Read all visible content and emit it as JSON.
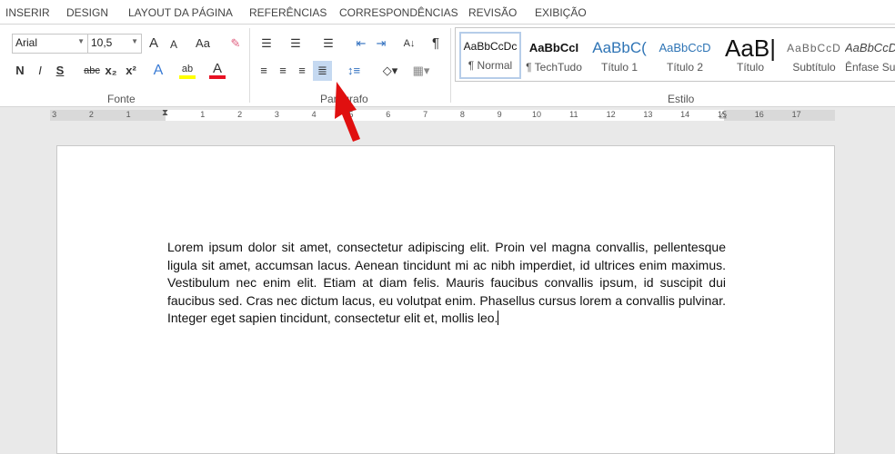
{
  "tabs": [
    "INSERIR",
    "DESIGN",
    "LAYOUT DA PÁGINA",
    "REFERÊNCIAS",
    "CORRESPONDÊNCIAS",
    "REVISÃO",
    "EXIBIÇÃO"
  ],
  "font": {
    "name": "Arial",
    "size": "10,5",
    "grow": "A",
    "shrink": "A",
    "case": "Aa",
    "bold": "N",
    "italic": "I",
    "underline": "S",
    "strike": "abc",
    "sub": "x₂",
    "sup": "x²",
    "effects": "A",
    "highlight": "ab",
    "color": "A",
    "group": "Fonte",
    "highlight_color": "#ffff00",
    "font_color": "#e81123"
  },
  "paragraph": {
    "group": "Paragrafo",
    "sort": "A↓",
    "pilcrow": "¶"
  },
  "styles": {
    "group": "Estilo",
    "items": [
      {
        "preview": "AaBbCcDc",
        "name": "¶ Normal"
      },
      {
        "preview": "AaBbCcI",
        "name": "¶ TechTudo"
      },
      {
        "preview": "AaBbC(",
        "name": "Título 1"
      },
      {
        "preview": "AaBbCcD",
        "name": "Título 2"
      },
      {
        "preview": "AaB|",
        "name": "Título"
      },
      {
        "preview": "AaBbCcD",
        "name": "Subtítulo"
      },
      {
        "preview": "AaBbCcD",
        "name": "Ênfase Sut"
      }
    ]
  },
  "ruler": {
    "left": [
      "3",
      "2",
      "1"
    ],
    "right": [
      "1",
      "2",
      "3",
      "4",
      "5",
      "6",
      "7",
      "8",
      "9",
      "10",
      "11",
      "12",
      "13",
      "14",
      "15",
      "16",
      "17"
    ]
  },
  "document": {
    "text": "Lorem ipsum dolor sit amet, consectetur adipiscing elit. Proin vel magna convallis, pellentesque ligula sit amet, accumsan lacus. Aenean tincidunt mi ac nibh imperdiet, id ultrices enim maximus. Vestibulum nec enim elit. Etiam at diam felis. Mauris faucibus convallis ipsum, id suscipit dui faucibus sed. Cras nec dictum lacus, eu volutpat enim. Phasellus cursus lorem a convallis pulvinar. Integer eget sapien tincidunt, consectetur elit et, mollis leo."
  }
}
